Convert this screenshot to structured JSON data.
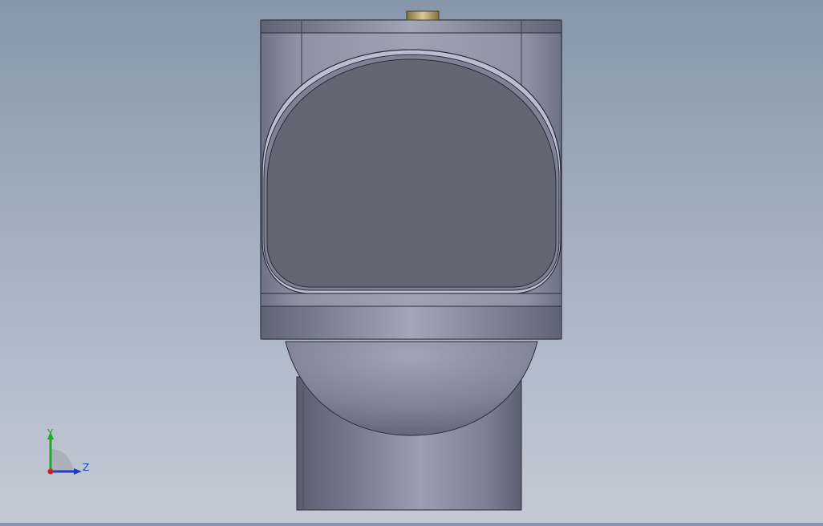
{
  "viewport": {
    "background_top": "#8796ab",
    "background_bottom": "#c3cad5"
  },
  "model": {
    "body_color": "#8f94a4",
    "window_color": "#616773",
    "fitting_color": "#b6a273"
  },
  "triad": {
    "y_label": "Y",
    "z_label": "Z",
    "y_color": "#1faa2a",
    "z_color": "#1f3fbf",
    "x_color": "#d41f1f"
  }
}
